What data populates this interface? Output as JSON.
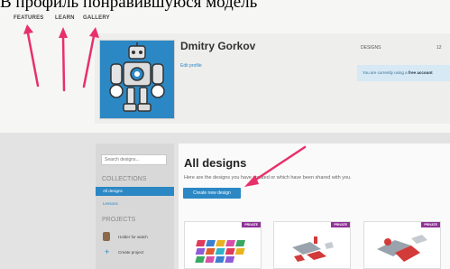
{
  "caption": "В профиль понравившуюся модель",
  "nav": {
    "features": "FEATURES",
    "learn": "LEARN",
    "gallery": "GALLERY"
  },
  "profile": {
    "name": "Dmitry Gorkov",
    "edit": "Edit profile",
    "stats_label": "DESIGNS",
    "stats_count": "12",
    "account_prefix": "You are currently using a ",
    "account_type": "free account"
  },
  "sidebar": {
    "search_placeholder": "Search designs...",
    "collections_title": "COLLECTIONS",
    "items": [
      {
        "label": "All designs"
      },
      {
        "label": "Lessons"
      }
    ],
    "projects_title": "PROJECTS",
    "projects": [
      {
        "label": "Holder for watch"
      },
      {
        "label": "Create project"
      }
    ]
  },
  "main": {
    "title": "All designs",
    "subtitle": "Here are the designs you have created or which have been shared with you.",
    "create_button": "Create new design",
    "cards": [
      {
        "badge": "PRIVATE"
      },
      {
        "badge": "PRIVATE"
      },
      {
        "badge": "PRIVATE"
      }
    ]
  },
  "colors": {
    "accent": "#2b88c4",
    "arrow": "#e8306a",
    "badge": "#8e3096"
  },
  "icons": [
    "robot-avatar-icon",
    "holder-icon",
    "plus-icon"
  ]
}
